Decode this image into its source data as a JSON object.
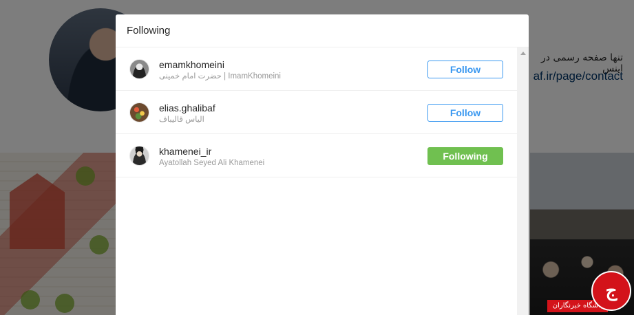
{
  "background": {
    "bio_text": "تنها صفحه رسمی در اینس",
    "link_text": "af.ir/page/contact"
  },
  "modal": {
    "title": "Following",
    "users": [
      {
        "username": "emamkhomeini",
        "fullname": "حضرت امام خمینی | ImamKhomeini",
        "button": "Follow",
        "state": "follow"
      },
      {
        "username": "elias.ghalibaf",
        "fullname": "الیاس قالیباف",
        "button": "Follow",
        "state": "follow"
      },
      {
        "username": "khamenei_ir",
        "fullname": "Ayatollah Seyed Ali Khamenei",
        "button": "Following",
        "state": "following"
      }
    ]
  },
  "watermark": {
    "text": "باشگاه خبرنگاران"
  },
  "colors": {
    "follow_blue": "#3897f0",
    "following_green": "#70c050",
    "overlay": "rgba(0,0,0,0.5)"
  }
}
